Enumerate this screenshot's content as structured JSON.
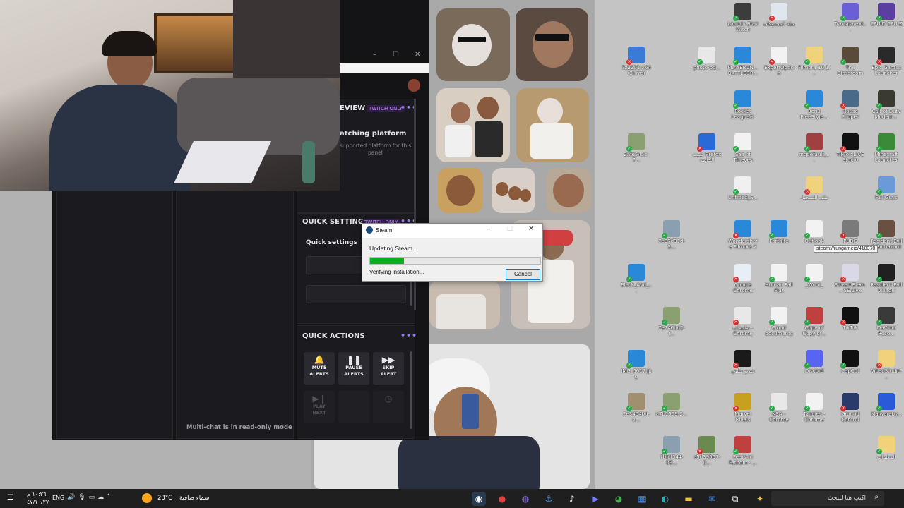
{
  "streamlabs": {
    "preview_header": "EVIEW",
    "twitch_badge_1": "TWITCH ONLY",
    "watching_title": "atching platform",
    "watching_sub_1": "supported platform for this",
    "watching_sub_2": "panel",
    "quick_settings_header": "QUICK SETTINGS",
    "twitch_badge_2": "TWITCH ONLY",
    "quick_settings_label": "Quick settings",
    "quick_actions_header": "QUICK ACTIONS",
    "actions": [
      {
        "line1": "MUTE",
        "line2": "ALERTS"
      },
      {
        "line1": "PAUSE",
        "line2": "ALERTS"
      },
      {
        "line1": "SKIP",
        "line2": "ALERT"
      },
      {
        "line1": "PLAY",
        "line2": "NEXT"
      }
    ],
    "multichat_note": "Multi-chat is in read-only mode",
    "dots": "•••"
  },
  "steam": {
    "title": "Steam",
    "updating": "Updating Steam...",
    "verifying": "Verifying installation...",
    "cancel": "Cancel",
    "progress": 0.2
  },
  "tooltip": "steam://rungameid/418370",
  "desktop_icons": [
    {
      "label": "Launch Blair Witch",
      "color": "#3c3c3c"
    },
    {
      "label": "سلة المحذوفات",
      "color": "#dfe6ee"
    },
    {
      "label": "Transparent...",
      "color": "#6b5fd6"
    },
    {
      "label": "CPUID CPU-Z",
      "color": "#5a3fa0"
    },
    {
      "label": "7z2201-x64 (3).msi",
      "color": "#3a7bd5"
    },
    {
      "label": "photo-od...",
      "color": "#e8e8e8"
    },
    {
      "label": "PLAYERUN... BATTLEGR...",
      "color": "#2a88d8"
    },
    {
      "label": "ExpertOption",
      "color": "#f2f2f2"
    },
    {
      "label": "Filmora.10.1...",
      "color": "#f0d27a"
    },
    {
      "label": "The Classroom",
      "color": "#5a4a3a"
    },
    {
      "label": "Epic Games Launcher",
      "color": "#2a2a2a"
    },
    {
      "label": "Rocket League®",
      "color": "#2a88d8"
    },
    {
      "label": "3on3 FreeStyle...",
      "color": "#2a88d8"
    },
    {
      "label": "House Flipper",
      "color": "#4a6a8a"
    },
    {
      "label": "Call of Duty Modern...",
      "color": "#3a3a30"
    },
    {
      "label": "2afe545c-7...",
      "color": "#8aa070"
    },
    {
      "label": "تثبيت Firefox الخاصة",
      "color": "#2a6ad8"
    },
    {
      "label": "Sea of Thieves",
      "color": "#f2f2f2"
    },
    {
      "label": "mqdefault_...",
      "color": "#a04040"
    },
    {
      "label": "TikTok LIVE Studio",
      "color": "#111111"
    },
    {
      "label": "Minecraft Launcher",
      "color": "#3a8a3a"
    },
    {
      "label": "Untitled_S...",
      "color": "#f0f0f0"
    },
    {
      "label": "ملف التسجيل",
      "color": "#f0d27a"
    },
    {
      "label": "Fall Guys",
      "color": "#6a9ad8"
    },
    {
      "label": "7e37d31d-3...",
      "color": "#8aa0b0"
    },
    {
      "label": "Wondershare Filmora X",
      "color": "#2a88d8"
    },
    {
      "label": "Fortnite",
      "color": "#2a88d8"
    },
    {
      "label": "Outlook",
      "color": "#f2f2f2"
    },
    {
      "label": "PUBG",
      "color": "#7a7a7a"
    },
    {
      "label": "Resident Evil 2 Biohazard",
      "color": "#6a5040"
    },
    {
      "label": "Black_And_...",
      "color": "#2a88d8"
    },
    {
      "label": "Google Chrome",
      "color": "#e8eef5"
    },
    {
      "label": "Human Fall Flat",
      "color": "#f2f2f2"
    },
    {
      "label": "_Word_",
      "color": "#f2f2f2"
    },
    {
      "label": "StreamElem... SE.Live",
      "color": "#d8d8e8"
    },
    {
      "label": "Resident Evil Village",
      "color": "#202020"
    },
    {
      "label": "7e746bd2-f...",
      "color": "#8aa070"
    },
    {
      "label": "تطبيقات - Chrome",
      "color": "#e8e8e8"
    },
    {
      "label": "Cloud documents",
      "color": "#f2f2f2"
    },
    {
      "label": "Copy of Copy of...",
      "color": "#c04040"
    },
    {
      "label": "TikTok",
      "color": "#111111"
    },
    {
      "label": "DaVinci Reso...",
      "color": "#3a3a3a"
    },
    {
      "label": "IMG_6617.jpg",
      "color": "#2a88d8"
    },
    {
      "label": "فيديو فتلتي",
      "color": "#1a1a1a"
    },
    {
      "label": "Discord",
      "color": "#5865f2"
    },
    {
      "label": "CapCut",
      "color": "#111111"
    },
    {
      "label": "VideoStudio...",
      "color": "#f0d27a"
    },
    {
      "label": "2e3404bd-a...",
      "color": "#a09070"
    },
    {
      "label": "a7b1559-2...",
      "color": "#8aa070"
    },
    {
      "label": "Marvel Rivals",
      "color": "#c8a020"
    },
    {
      "label": "KSA - Chrome",
      "color": "#e8e8e8"
    },
    {
      "label": "Tangles - Chrome",
      "color": "#f2f2f2"
    },
    {
      "label": "Ground Control",
      "color": "#2a3a6a"
    },
    {
      "label": "Malwareby...",
      "color": "#2a5ad8"
    },
    {
      "label": "7bfcf544-09...",
      "color": "#8aa0b0"
    },
    {
      "label": "a5d39567-0...",
      "color": "#6a8a50"
    },
    {
      "label": "Fears to Fathom - ...",
      "color": "#c04040"
    },
    {
      "label": "المعلمات",
      "color": "#f0d27a"
    }
  ],
  "taskbar": {
    "search_placeholder": "اكتب هنا للبحث",
    "weather_temp": "23°C",
    "weather_text": "سماء صافية",
    "language": "ENG",
    "time": "١٠:٢٦ م",
    "date": "٤٧/١٠/٢٧"
  }
}
